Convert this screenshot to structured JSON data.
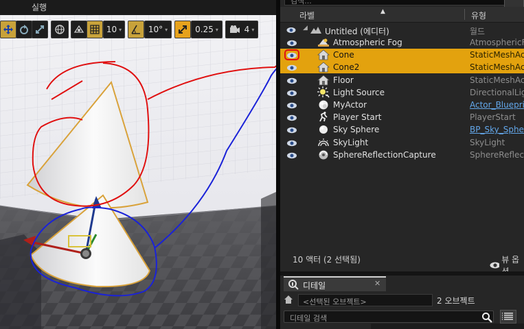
{
  "menu": {
    "run_label": "실행"
  },
  "viewport_toolbar": {
    "grid_snap_value": "10",
    "rotation_snap_value": "10°",
    "scale_snap_value": "0.25",
    "camera_speed_value": "4"
  },
  "outliner": {
    "search_placeholder": "검색...",
    "column_label": "라벨",
    "column_type": "유형",
    "root": {
      "label": "Untitled (에디터)",
      "type": "월드"
    },
    "rows": [
      {
        "label": "Atmospheric Fog",
        "type": "AtmosphericFog",
        "icon": "atmospheric-fog-icon",
        "selected": false,
        "type_link": false
      },
      {
        "label": "Cone",
        "type": "StaticMeshActor",
        "icon": "static-mesh-icon",
        "selected": true,
        "type_link": false
      },
      {
        "label": "Cone2",
        "type": "StaticMeshActor",
        "icon": "static-mesh-icon",
        "selected": true,
        "type_link": false
      },
      {
        "label": "Floor",
        "type": "StaticMeshActor",
        "icon": "static-mesh-icon",
        "selected": false,
        "type_link": false
      },
      {
        "label": "Light Source",
        "type": "DirectionalLight",
        "icon": "directional-light-icon",
        "selected": false,
        "type_link": false
      },
      {
        "label": "MyActor",
        "type": "Actor_Blueprint",
        "icon": "actor-sphere-icon",
        "selected": false,
        "type_link": true
      },
      {
        "label": "Player Start",
        "type": "PlayerStart",
        "icon": "player-start-icon",
        "selected": false,
        "type_link": false
      },
      {
        "label": "Sky Sphere",
        "type": "BP_Sky_Sphere",
        "icon": "sky-sphere-icon",
        "selected": false,
        "type_link": true
      },
      {
        "label": "SkyLight",
        "type": "SkyLight",
        "icon": "sky-light-icon",
        "selected": false,
        "type_link": false
      },
      {
        "label": "SphereReflectionCapture",
        "type": "SphereReflectionCapture",
        "icon": "reflection-capture-icon",
        "selected": false,
        "type_link": false
      }
    ],
    "status": "10 액터 (2 선택됨)",
    "view_options_label": "뷰 옵션"
  },
  "details": {
    "tab_title": "디테일",
    "tab_close": "✕",
    "selected_objects_text": "<선택된 오브젝트>",
    "object_count": "2 오브젝트",
    "search_placeholder": "디테일 검색"
  },
  "colors": {
    "selection": "#e3a20e",
    "link": "#63a7ea",
    "annotation_red": "#e01010",
    "annotation_blue": "#1a22d8",
    "cone_outline": "#d9a23a"
  }
}
